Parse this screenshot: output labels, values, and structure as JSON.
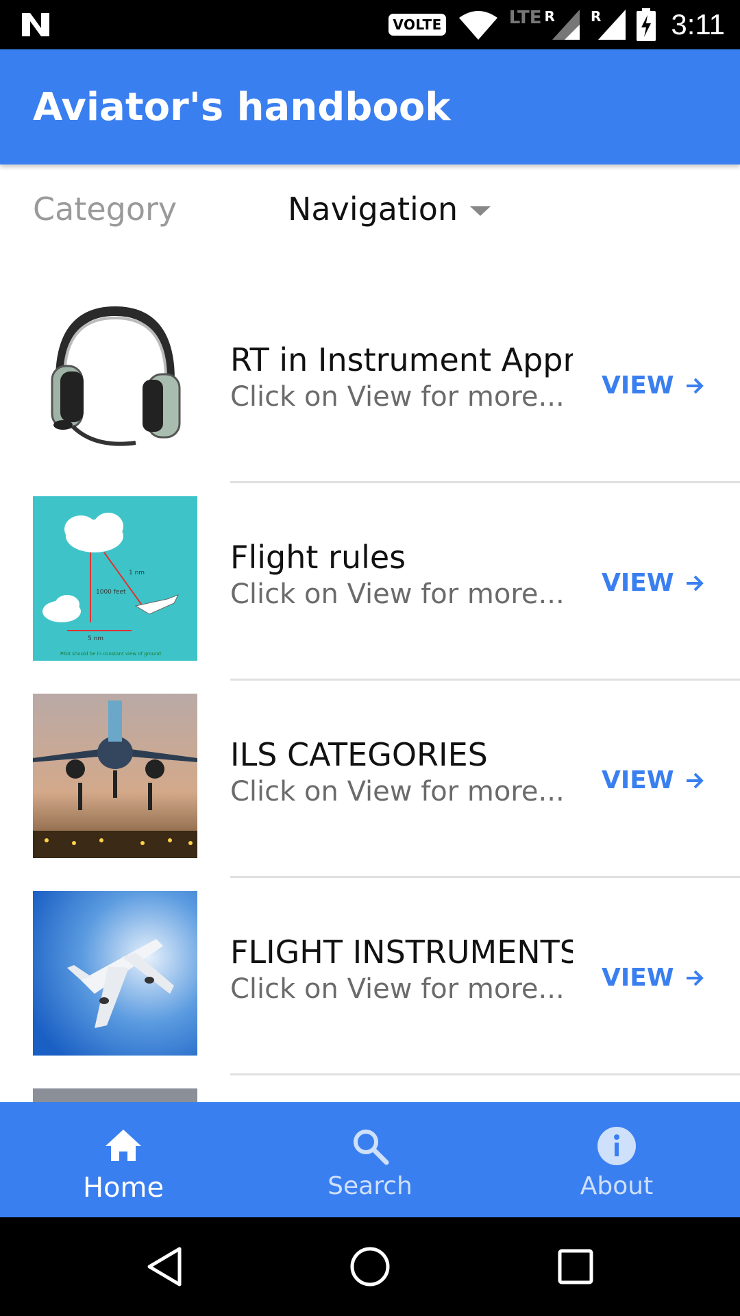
{
  "status_bar": {
    "volte": "VOLTE",
    "network": "LTE",
    "roaming_1": "R",
    "roaming_2": "R",
    "time": "3:11"
  },
  "app_bar": {
    "title": "Aviator's handbook"
  },
  "category": {
    "label": "Category",
    "selected": "Navigation"
  },
  "list": {
    "items": [
      {
        "title": "RT in Instrument Approach",
        "subtitle": "Click on View for more...",
        "action": "VIEW",
        "thumbnail": "headset-image"
      },
      {
        "title": "Flight rules",
        "subtitle": "Click on View for more...",
        "action": "VIEW",
        "thumbnail": "flight-rules-diagram-image"
      },
      {
        "title": "ILS CATEGORIES",
        "subtitle": "Click on View for more...",
        "action": "VIEW",
        "thumbnail": "landing-aircraft-image"
      },
      {
        "title": "FLIGHT INSTRUMENTS",
        "subtitle": "Click on View for more...",
        "action": "VIEW",
        "thumbnail": "aircraft-sky-image"
      }
    ]
  },
  "bottom_nav": {
    "items": [
      {
        "label": "Home",
        "icon": "home-icon",
        "active": true
      },
      {
        "label": "Search",
        "icon": "search-icon",
        "active": false
      },
      {
        "label": "About",
        "icon": "info-icon",
        "active": false
      }
    ]
  },
  "diagram_labels": {
    "altitude": "1000 feet",
    "distance_1": "1 nm",
    "distance_2": "5 nm",
    "caption": "Pilot should be in constant view of ground"
  },
  "colors": {
    "primary": "#3a7ff0",
    "status_bar": "#000000",
    "divider": "#e0e0e0"
  }
}
